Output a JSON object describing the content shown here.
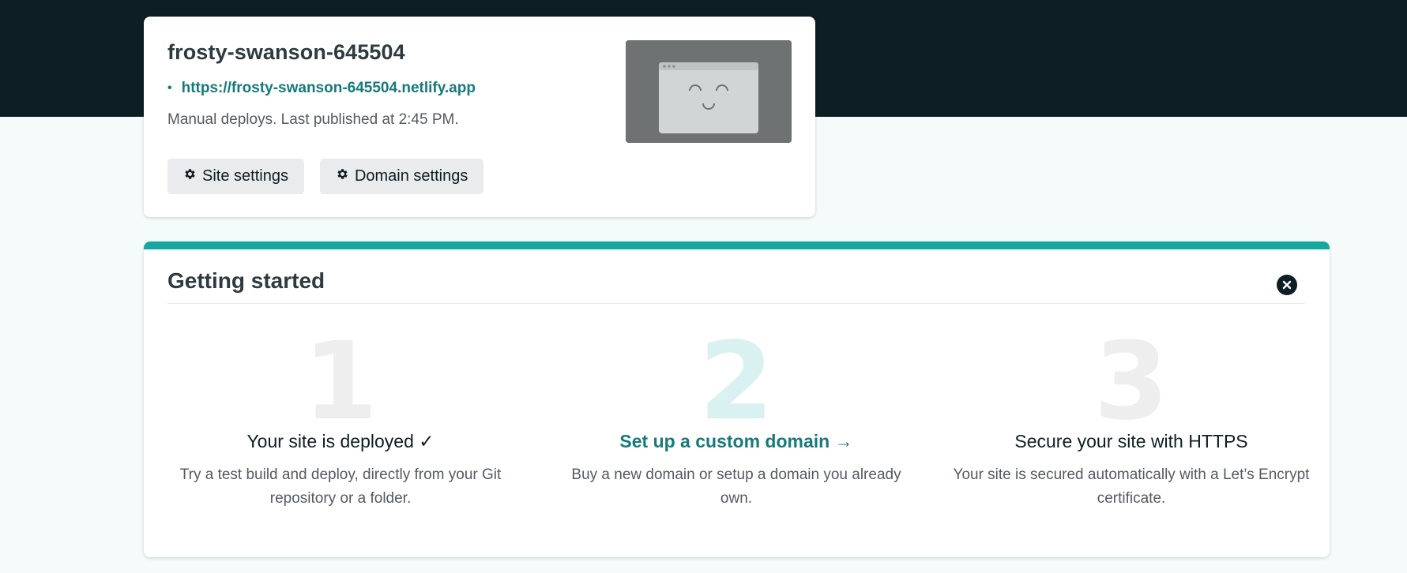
{
  "site": {
    "name": "frosty-swanson-645504",
    "url": "https://frosty-swanson-645504.netlify.app",
    "bullet": "•",
    "deploy_info": "Manual deploys. Last published at 2:45 PM.",
    "buttons": {
      "site_settings": "Site settings",
      "domain_settings": "Domain settings"
    }
  },
  "getting_started": {
    "title": "Getting started",
    "steps": [
      {
        "number": "1",
        "title": "Your site is deployed ✓",
        "description": "Try a test build and deploy, directly from your Git repository or a folder."
      },
      {
        "number": "2",
        "title": "Set up a custom domain →",
        "description": "Buy a new domain or setup a domain you already own."
      },
      {
        "number": "3",
        "title": "Secure your site with HTTPS",
        "description": "Your site is secured automatically with a Let’s Encrypt certificate."
      }
    ]
  },
  "colors": {
    "dark": "#0e1e25",
    "accent": "#15a8a0",
    "link": "#167a7a",
    "background": "#f5fbfb"
  },
  "icons": [
    "gear-icon",
    "close-icon",
    "site-preview-face-icon"
  ]
}
